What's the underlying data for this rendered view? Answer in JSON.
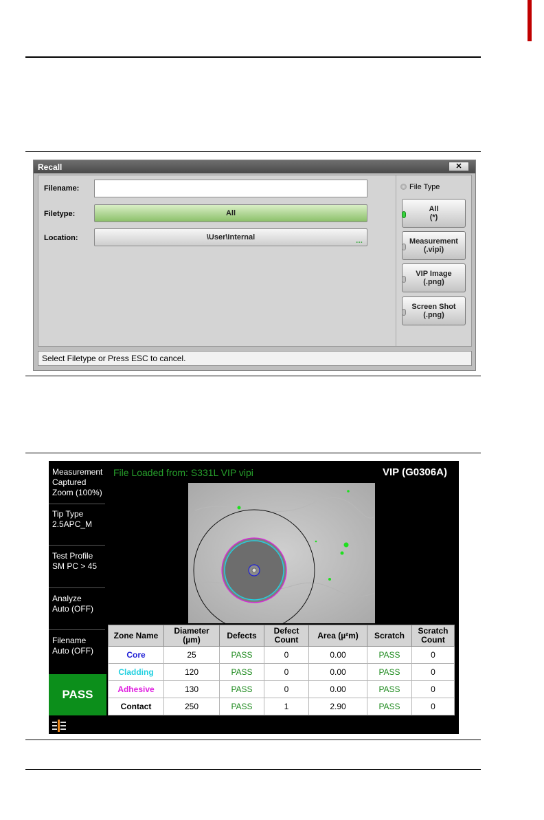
{
  "recall_dialog": {
    "title": "Recall",
    "close_glyph": "✕",
    "filename_label": "Filename:",
    "filename_value": "",
    "filetype_label": "Filetype:",
    "filetype_value": "All",
    "location_label": "Location:",
    "location_value": "\\User\\Internal",
    "location_more": "...",
    "file_type_heading": "File Type",
    "file_type_options": [
      {
        "line1": "All",
        "line2": "(*)",
        "selected": true
      },
      {
        "line1": "Measurement",
        "line2": "(.vipi)",
        "selected": false
      },
      {
        "line1": "VIP Image",
        "line2": "(.png)",
        "selected": false
      },
      {
        "line1": "Screen Shot",
        "line2": "(.png)",
        "selected": false
      }
    ],
    "status_text": "Select Filetype or Press ESC to cancel."
  },
  "vip_screen": {
    "file_loaded": "File Loaded from: S331L VIP vipi",
    "title": "VIP (G0306A)",
    "sidebar": {
      "measurement": [
        "Measurement",
        "Captured",
        "Zoom (100%)"
      ],
      "tip_type": [
        "Tip Type",
        "2.5APC_M"
      ],
      "test_profile": [
        "Test Profile",
        "SM PC > 45"
      ],
      "analyze": [
        "Analyze",
        "Auto (OFF)"
      ],
      "filename": [
        "Filename",
        "Auto (OFF)"
      ]
    },
    "result": "PASS",
    "table": {
      "headers": [
        [
          "Zone Name",
          ""
        ],
        [
          "Diameter",
          "(µm)"
        ],
        [
          "Defects",
          ""
        ],
        [
          "Defect",
          "Count"
        ],
        [
          "Area (µ²m)",
          ""
        ],
        [
          "Scratch",
          ""
        ],
        [
          "Scratch",
          "Count"
        ]
      ],
      "rows": [
        {
          "zone": "Core",
          "color": "#1f1fd6",
          "diameter": "25",
          "defects": "PASS",
          "defect_count": "0",
          "area": "0.00",
          "scratch": "PASS",
          "scratch_count": "0"
        },
        {
          "zone": "Cladding",
          "color": "#22d0e0",
          "diameter": "120",
          "defects": "PASS",
          "defect_count": "0",
          "area": "0.00",
          "scratch": "PASS",
          "scratch_count": "0"
        },
        {
          "zone": "Adhesive",
          "color": "#e020e0",
          "diameter": "130",
          "defects": "PASS",
          "defect_count": "0",
          "area": "0.00",
          "scratch": "PASS",
          "scratch_count": "0"
        },
        {
          "zone": "Contact",
          "color": "#000000",
          "diameter": "250",
          "defects": "PASS",
          "defect_count": "1",
          "area": "2.90",
          "scratch": "PASS",
          "scratch_count": "0"
        }
      ]
    },
    "icons": {
      "tool": "tool-icon"
    }
  }
}
